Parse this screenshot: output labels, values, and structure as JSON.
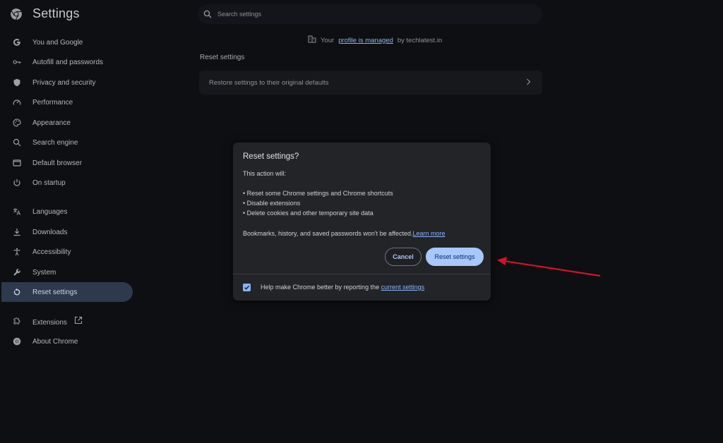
{
  "header": {
    "title": "Settings",
    "search_placeholder": "Search settings"
  },
  "sidebar": {
    "items": [
      {
        "label": "You and Google",
        "icon": "google-g-icon"
      },
      {
        "label": "Autofill and passwords",
        "icon": "key-icon"
      },
      {
        "label": "Privacy and security",
        "icon": "shield-icon"
      },
      {
        "label": "Performance",
        "icon": "speedometer-icon"
      },
      {
        "label": "Appearance",
        "icon": "palette-icon"
      },
      {
        "label": "Search engine",
        "icon": "search-icon"
      },
      {
        "label": "Default browser",
        "icon": "browser-window-icon"
      },
      {
        "label": "On startup",
        "icon": "power-icon"
      },
      {
        "label": "Languages",
        "icon": "translate-icon"
      },
      {
        "label": "Downloads",
        "icon": "download-icon"
      },
      {
        "label": "Accessibility",
        "icon": "accessibility-icon"
      },
      {
        "label": "System",
        "icon": "wrench-icon"
      },
      {
        "label": "Reset settings",
        "icon": "reset-icon",
        "active": true
      },
      {
        "label": "Extensions",
        "icon": "puzzle-icon"
      },
      {
        "label": "About Chrome",
        "icon": "chrome-icon"
      }
    ]
  },
  "managed": {
    "prefix": "Your",
    "link": "profile is managed",
    "suffix": "by techlatest.in"
  },
  "main": {
    "section_title": "Reset settings",
    "row_label": "Restore settings to their original defaults"
  },
  "dialog": {
    "title": "Reset settings?",
    "intro": "This action will:",
    "bullets": [
      "• Reset some Chrome settings and Chrome shortcuts",
      "• Disable extensions",
      "• Delete cookies and other temporary site data"
    ],
    "note": "Bookmarks, history, and saved passwords won't be affected.",
    "learn_more": "Learn more",
    "cancel_label": "Cancel",
    "reset_label": "Reset settings",
    "footer_text": "Help make Chrome better by reporting the",
    "footer_link": "current settings",
    "checkbox_checked": true
  },
  "colors": {
    "accent": "#a8c7fa",
    "link": "#8ab4f8",
    "active_nav_bg": "#2d3a4d",
    "annotation_arrow": "#d3122a"
  }
}
